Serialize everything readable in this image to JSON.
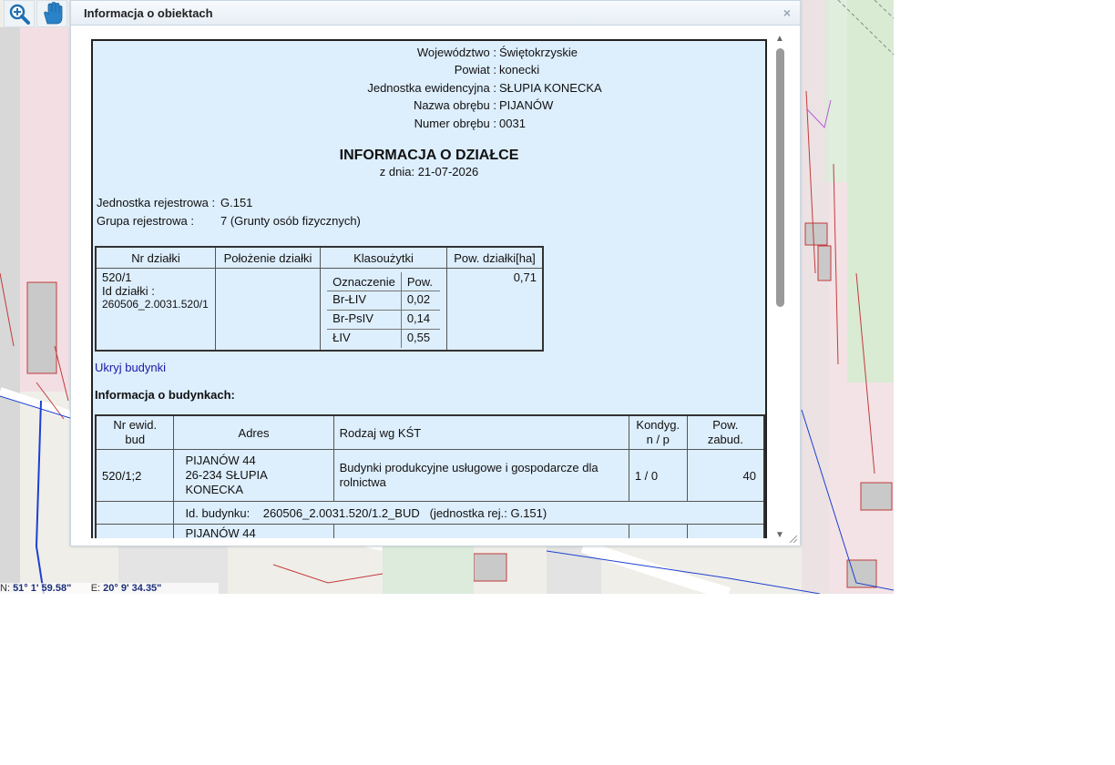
{
  "window": {
    "title": "Informacja o obiektach",
    "close_glyph": "×"
  },
  "toolbar": [
    {
      "name": "zoom-in-icon",
      "color": "#1f6fb2"
    },
    {
      "name": "pan-hand-icon",
      "color": "#2a82c9"
    }
  ],
  "coords": {
    "n_label": "N:",
    "n_value": "51° 1' 59.58\"",
    "e_label": "E:",
    "e_value": "20° 9' 34.35\""
  },
  "location": [
    {
      "label": "Województwo :",
      "value": "Świętokrzyskie"
    },
    {
      "label": "Powiat :",
      "value": "konecki"
    },
    {
      "label": "Jednostka ewidencyjna :",
      "value": "SŁUPIA KONECKA"
    },
    {
      "label": "Nazwa obrębu :",
      "value": "PIJANÓW"
    },
    {
      "label": "Numer obrębu :",
      "value": "0031"
    }
  ],
  "doc": {
    "title": "INFORMACJA O DZIAŁCE",
    "date": "z dnia: 21-07-2026"
  },
  "registry": {
    "unit_label": "Jednostka rejestrowa :",
    "unit_value": "G.151",
    "group_label": "Grupa rejestrowa :",
    "group_value": "7 (Grunty osób fizycznych)"
  },
  "plots": {
    "headers": [
      "Nr działki",
      "Położenie działki",
      "Klasoużytki",
      "Pow. działki[ha]"
    ],
    "row": {
      "nr": "520/1",
      "id_label": "Id działki :",
      "id_value": "260506_2.0031.520/1",
      "position": "",
      "area": "0,71",
      "use_headers": [
        "Oznaczenie",
        "Pow."
      ],
      "uses": [
        {
          "code": "Br-ŁIV",
          "area": "0,02"
        },
        {
          "code": "Br-PsIV",
          "area": "0,14"
        },
        {
          "code": "ŁIV",
          "area": "0,55"
        }
      ]
    }
  },
  "hide_buildings_link": "Ukryj budynki",
  "buildings": {
    "title": "Informacja o budynkach:",
    "headers": [
      "Nr ewid.\nbud",
      "Adres",
      "Rodzaj wg KŚT",
      "Kondyg.\nn / p",
      "Pow.\nzabud."
    ],
    "rows": [
      {
        "nr": "520/1;2",
        "address_lines": [
          "PIJANÓW 44",
          "26-234 SŁUPIA",
          "KONECKA"
        ],
        "type": "Budynki produkcyjne usługowe i gospodarcze dla rolnictwa",
        "storeys": "1 / 0",
        "area": "40",
        "id_label": "Id. budynku:",
        "id_value": "260506_2.0031.520/1.2_BUD",
        "id_unit": "(jednostka rej.: G.151)"
      },
      {
        "address_lines": [
          "PIJANÓW 44"
        ]
      }
    ]
  },
  "colors": {
    "content_bg": "#ddeefd",
    "link": "#1a1aa6",
    "map_bg": "#f0eee9"
  }
}
